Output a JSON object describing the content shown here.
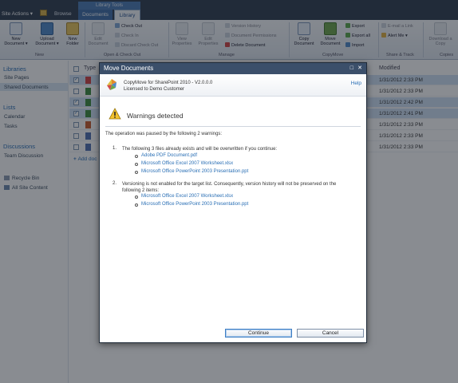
{
  "topbar": {
    "site_actions": "Site Actions ▾",
    "browse_tab": "Browse",
    "context_label": "Library Tools",
    "documents_tab": "Documents",
    "library_tab": "Library"
  },
  "ribbon": {
    "new_document": "New Document ▾",
    "upload_document": "Upload Document ▾",
    "new_folder": "New Folder",
    "edit_document": "Edit Document",
    "check_out": "Check Out",
    "check_in": "Check In",
    "discard_check_out": "Discard Check Out",
    "view_properties": "View Properties",
    "edit_properties": "Edit Properties",
    "version_history": "Version History",
    "document_permissions": "Document Permissions",
    "delete_document": "Delete Document",
    "copy_document": "Copy Document",
    "move_document": "Move Document",
    "export": "Export",
    "export_all": "Export all",
    "import": "Import",
    "email_link": "E-mail a Link",
    "alert_me": "Alert Me ▾",
    "download_copy": "Download a Copy",
    "groups": {
      "new": "New",
      "open_checkout": "Open & Check Out",
      "manage": "Manage",
      "copymove": "CopyMove",
      "share_track": "Share & Track",
      "copies": "Copies"
    }
  },
  "leftnav": {
    "libraries": "Libraries",
    "site_pages": "Site Pages",
    "shared_documents": "Shared Documents",
    "lists": "Lists",
    "calendar": "Calendar",
    "tasks": "Tasks",
    "discussions": "Discussions",
    "team_discussion": "Team Discussion",
    "recycle_bin": "Recycle Bin",
    "all_site_content": "All Site Content"
  },
  "list": {
    "col_type": "Type",
    "col_modified": "Modified",
    "rows": [
      {
        "modified": "1/31/2012 2:33 PM",
        "selected": true
      },
      {
        "modified": "1/31/2012 2:33 PM",
        "selected": false
      },
      {
        "modified": "1/31/2012 2:42 PM",
        "selected": true
      },
      {
        "modified": "1/31/2012 2:41 PM",
        "selected": true
      },
      {
        "modified": "1/31/2012 2:33 PM",
        "selected": false
      },
      {
        "modified": "1/31/2012 2:33 PM",
        "selected": false
      },
      {
        "modified": "1/31/2012 2:33 PM",
        "selected": false
      }
    ],
    "add_document": "Add doc"
  },
  "dialog": {
    "title": "Move Documents",
    "product_name": "CopyMove for SharePoint 2010 - V2.0.0.0",
    "license": "Licensed to Demo Customer",
    "help": "Help",
    "warning_title": "Warnings detected",
    "intro": "The operation was paused by the following 2 warnings:",
    "warnings": [
      {
        "num": "1.",
        "text": "The following 3 files already exists and will be overwritten if you continue:",
        "files": [
          "Adobe PDF Document.pdf",
          "Microsoft Office Excel 2007 Worksheet.xlsx",
          "Microsoft Office PowerPoint 2003 Presentation.ppt"
        ]
      },
      {
        "num": "2.",
        "text": "Versioning is not enabled for the target list. Consequently, version history will not be preserved on the following 2 items:",
        "files": [
          "Microsoft Office Excel 2007 Worksheet.xlsx",
          "Microsoft Office PowerPoint 2003 Presentation.ppt"
        ]
      }
    ],
    "continue_button": "Continue",
    "cancel_button": "Cancel"
  },
  "colors": {
    "title_bar": "#3b4f6a",
    "link": "#2a6fb5",
    "selection": "#cfe1f4"
  }
}
